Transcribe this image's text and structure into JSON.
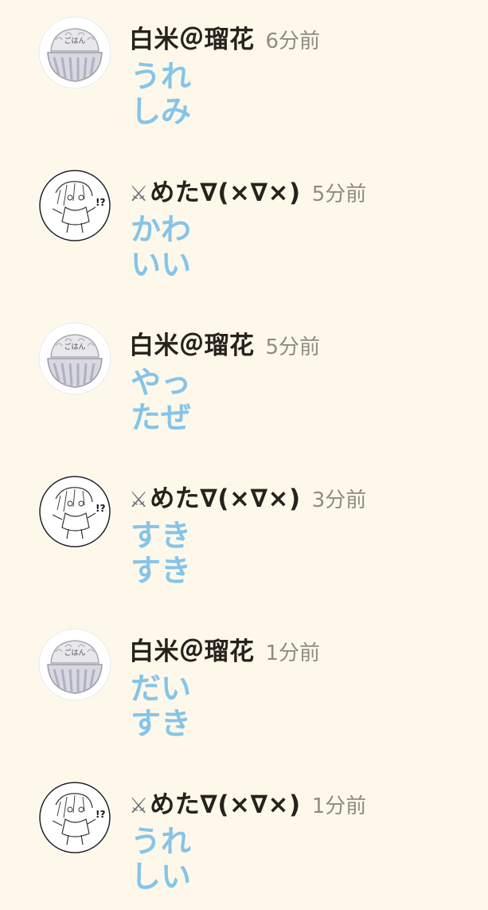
{
  "comments": [
    {
      "avatar": "rice-bowl-avatar",
      "username": "白米＠瑠花",
      "username_icon": "",
      "time": "6分前",
      "message": "うれしみ"
    },
    {
      "avatar": "meta-sketch-avatar",
      "username": "めた∇(×∇×)",
      "username_icon": "⚔",
      "time": "5分前",
      "message": "かわいい"
    },
    {
      "avatar": "rice-bowl-avatar",
      "username": "白米＠瑠花",
      "username_icon": "",
      "time": "5分前",
      "message": "やったぜ"
    },
    {
      "avatar": "meta-sketch-avatar",
      "username": "めた∇(×∇×)",
      "username_icon": "⚔",
      "time": "3分前",
      "message": "すきすき"
    },
    {
      "avatar": "rice-bowl-avatar",
      "username": "白米＠瑠花",
      "username_icon": "",
      "time": "1分前",
      "message": "だいすき"
    },
    {
      "avatar": "meta-sketch-avatar",
      "username": "めた∇(×∇×)",
      "username_icon": "⚔",
      "time": "1分前",
      "message": "うれしい"
    }
  ],
  "colors": {
    "background": "#fdf8ea",
    "username": "#26221c",
    "timestamp": "#8f8b82",
    "message": "#85c4e9"
  }
}
